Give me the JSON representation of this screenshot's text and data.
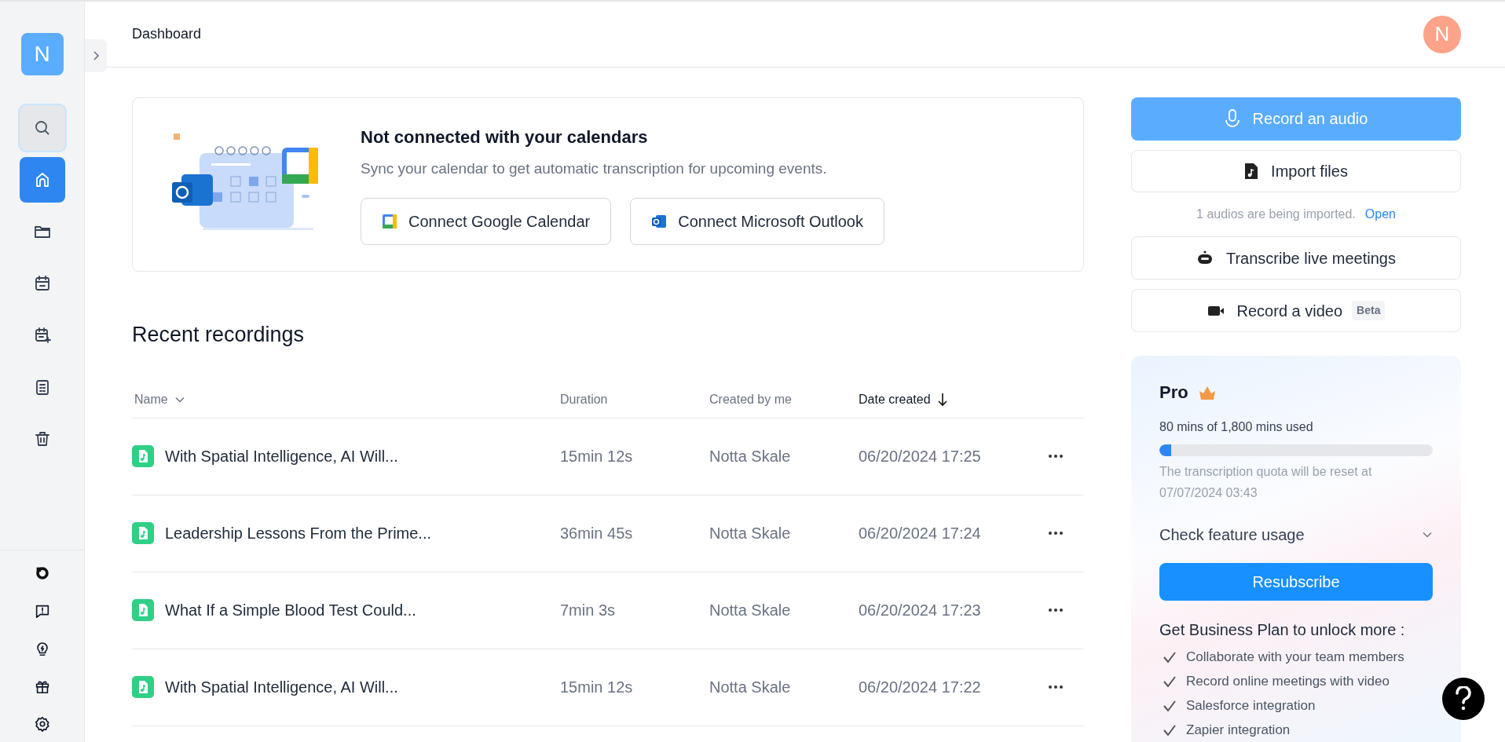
{
  "sidebar": {
    "logo_letter": "N",
    "items": [
      {
        "kind": "search",
        "selected": false
      },
      {
        "kind": "nav",
        "selected": true
      },
      {
        "kind": "nav",
        "selected": false
      },
      {
        "kind": "nav",
        "selected": false
      },
      {
        "kind": "nav",
        "selected": false
      },
      {
        "kind": "nav",
        "selected": false
      },
      {
        "kind": "nav",
        "selected": false
      }
    ]
  },
  "header": {
    "title": "Dashboard",
    "avatar_letter": "N"
  },
  "calendar_card": {
    "title": "Not connected with your calendars",
    "subtitle": "Sync your calendar to get automatic transcription for upcoming events.",
    "buttons": [
      "Connect Google Calendar",
      "Connect Microsoft Outlook"
    ]
  },
  "recent": {
    "title": "Recent recordings",
    "columns": [
      {
        "label": "Name",
        "sorted": false
      },
      {
        "label": "Duration",
        "sorted": false
      },
      {
        "label": "Created by me",
        "sorted": false
      },
      {
        "label": "Date created",
        "sorted": true
      }
    ],
    "rows": [
      {
        "name": "With Spatial Intelligence, AI Will...",
        "duration": "15min 12s",
        "creator": "Notta Skale",
        "date": "06/20/2024 17:25"
      },
      {
        "name": "Leadership Lessons From the Prime...",
        "duration": "36min 45s",
        "creator": "Notta Skale",
        "date": "06/20/2024 17:24"
      },
      {
        "name": "What If a Simple Blood Test Could...",
        "duration": "7min 3s",
        "creator": "Notta Skale",
        "date": "06/20/2024 17:23"
      },
      {
        "name": "With Spatial Intelligence, AI Will...",
        "duration": "15min 12s",
        "creator": "Notta Skale",
        "date": "06/20/2024 17:22"
      }
    ]
  },
  "actions": {
    "record_audio": "Record an audio",
    "import_files": "Import files",
    "import_status": "1 audios are being imported.",
    "import_link": "Open",
    "transcribe": "Transcribe live meetings",
    "record_video": "Record a video",
    "beta": "Beta"
  },
  "plan": {
    "name": "Pro",
    "usage": "80 mins of 1,800 mins used",
    "level": 0.044,
    "reset_note": "The transcription quota will be reset at 07/07/2024 03:43",
    "feature_usage": "Check feature usage",
    "resubscribe": "Resubscribe",
    "upsell": "Get Business Plan to unlock more :",
    "features": [
      "Collaborate with your team members",
      "Record online meetings with video",
      "Salesforce integration",
      "Zapier integration"
    ]
  }
}
